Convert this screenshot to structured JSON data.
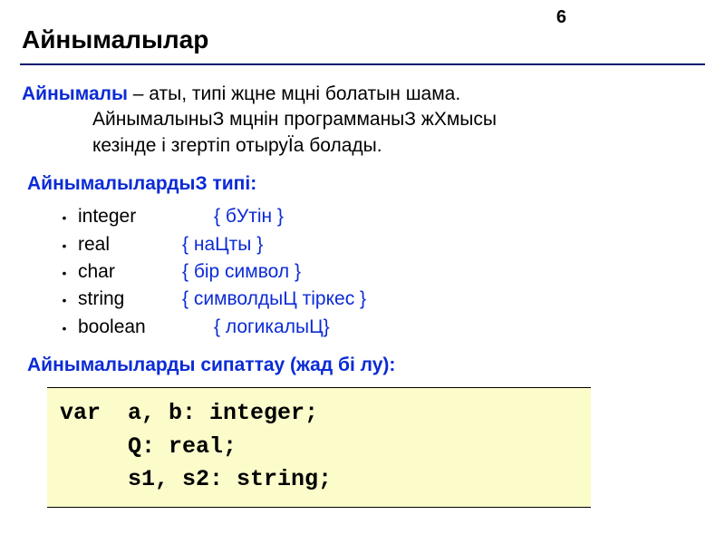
{
  "page_number": "6",
  "title": "Айнымалылар",
  "definition": {
    "term": "Айнымалы",
    "dash": " – ",
    "text1": "аты, типі жцне мцні болатын шама.",
    "text2": "АйнымалыныЗ мцнін программаныЗ жХмысы",
    "text3": "кезінде і згертіп отыруЇа болады."
  },
  "types_heading": "АйнымалылардыЗ типі:",
  "types": [
    {
      "name": "integer",
      "comment": "{ бУтін }",
      "pad": ""
    },
    {
      "name": "real",
      "comment": "{ наЦты }",
      "pad": ""
    },
    {
      "name": "char",
      "comment": "{ бір символ }",
      "pad": ""
    },
    {
      "name": "string",
      "comment": "{ символдыЦ тіркес }",
      "pad": ""
    },
    {
      "name": "boolean",
      "comment": "{ логикалыЦ}",
      "pad": ""
    }
  ],
  "declare_heading": "Айнымалыларды сипаттау (жад бі лу):",
  "code": {
    "l1": "var  a, b: integer;",
    "l2": "     Q: real;",
    "l3": "     s1, s2: string;"
  }
}
